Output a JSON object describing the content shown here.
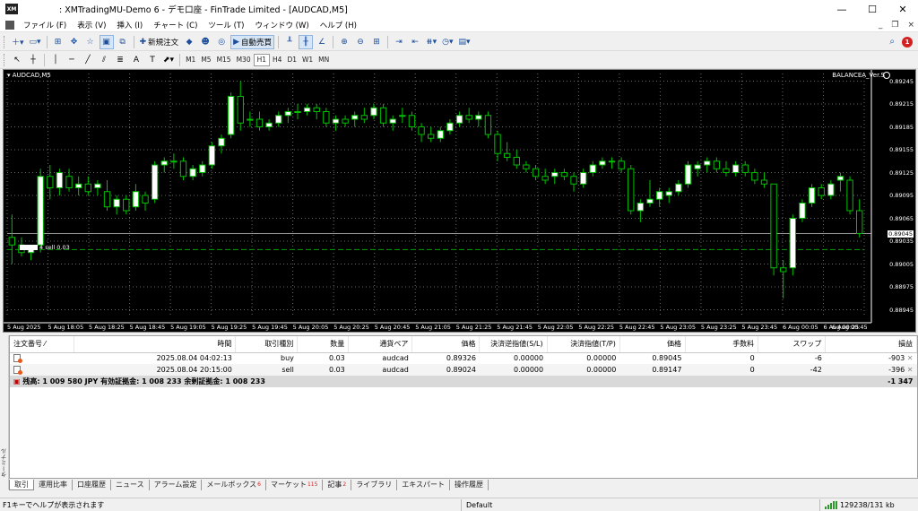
{
  "window": {
    "app_icon_text": "XM",
    "title": ": XMTradingMU-Demo 6 - デモ口座 - FinTrade Limited - [AUDCAD,M5]",
    "minimize": "—",
    "maximize": "☐",
    "close": "✕"
  },
  "menu": {
    "items": [
      "ファイル (F)",
      "表示 (V)",
      "挿入 (I)",
      "チャート (C)",
      "ツール (T)",
      "ウィンドウ (W)",
      "ヘルプ (H)"
    ],
    "mdi_minimize": "_",
    "mdi_restore": "❐",
    "mdi_close": "×"
  },
  "toolbar": {
    "new_order": "新規注文",
    "auto_trade": "自動売買",
    "notifications_count": "1",
    "timeframes": [
      "M1",
      "M5",
      "M15",
      "M30",
      "H1",
      "H4",
      "D1",
      "W1",
      "MN"
    ],
    "active_timeframe": "H1"
  },
  "chart": {
    "symbol": "AUDCAD,M5",
    "ea_label": "BALANCEA_Ver.S",
    "current_price": "0.89045",
    "order_label": "4 sell 0.03",
    "price_labels": [
      "0.89245",
      "0.89215",
      "0.89185",
      "0.89155",
      "0.89125",
      "0.89095",
      "0.89065",
      "0.89035",
      "0.89005",
      "0.88975",
      "0.88945"
    ],
    "time_labels": [
      "5 Aug 2025",
      "5 Aug 18:05",
      "5 Aug 18:25",
      "5 Aug 18:45",
      "5 Aug 19:05",
      "5 Aug 19:25",
      "5 Aug 19:45",
      "5 Aug 20:05",
      "5 Aug 20:25",
      "5 Aug 20:45",
      "5 Aug 21:05",
      "5 Aug 21:25",
      "5 Aug 21:45",
      "5 Aug 22:05",
      "5 Aug 22:25",
      "5 Aug 22:45",
      "5 Aug 23:05",
      "5 Aug 23:25",
      "5 Aug 23:45",
      "6 Aug 00:05",
      "6 Aug 00:25",
      "6 Aug 00:45"
    ],
    "colors": {
      "background": "#000000",
      "bull": "#ffffff",
      "bear": "#000000",
      "wick": "#00c000",
      "order_line": "#00a000"
    }
  },
  "chart_data": {
    "type": "candlestick",
    "title": "AUDCAD,M5",
    "xlabel": "",
    "ylabel": "",
    "ylim": [
      0.88935,
      0.89255
    ],
    "grid": true,
    "candles": [
      [
        0.8904,
        0.8907,
        0.89005,
        0.8903
      ],
      [
        0.8903,
        0.8904,
        0.89015,
        0.8902
      ],
      [
        0.8902,
        0.8903,
        0.8901,
        0.89025
      ],
      [
        0.8903,
        0.8913,
        0.8902,
        0.8912
      ],
      [
        0.8912,
        0.89135,
        0.8909,
        0.89105
      ],
      [
        0.89105,
        0.8913,
        0.89095,
        0.89125
      ],
      [
        0.8912,
        0.8913,
        0.891,
        0.89105
      ],
      [
        0.89105,
        0.8912,
        0.89095,
        0.8911
      ],
      [
        0.8911,
        0.8912,
        0.89095,
        0.891
      ],
      [
        0.89105,
        0.89115,
        0.89095,
        0.8911
      ],
      [
        0.891,
        0.89115,
        0.89075,
        0.8908
      ],
      [
        0.8908,
        0.89095,
        0.8907,
        0.8909
      ],
      [
        0.8909,
        0.89095,
        0.8907,
        0.89075
      ],
      [
        0.8908,
        0.8911,
        0.89075,
        0.891
      ],
      [
        0.89095,
        0.891,
        0.89075,
        0.89085
      ],
      [
        0.8909,
        0.8914,
        0.89085,
        0.89135
      ],
      [
        0.89135,
        0.89145,
        0.89125,
        0.8914
      ],
      [
        0.8914,
        0.8915,
        0.8913,
        0.8914
      ],
      [
        0.8914,
        0.89145,
        0.89115,
        0.8912
      ],
      [
        0.8912,
        0.89135,
        0.89115,
        0.8913
      ],
      [
        0.89125,
        0.8914,
        0.8912,
        0.89135
      ],
      [
        0.89135,
        0.89165,
        0.8913,
        0.8916
      ],
      [
        0.8916,
        0.89175,
        0.8915,
        0.8917
      ],
      [
        0.89175,
        0.8923,
        0.8917,
        0.89225
      ],
      [
        0.89225,
        0.89245,
        0.8918,
        0.8919
      ],
      [
        0.89195,
        0.89205,
        0.89185,
        0.89195
      ],
      [
        0.89195,
        0.89205,
        0.8918,
        0.89185
      ],
      [
        0.89185,
        0.89195,
        0.8918,
        0.8919
      ],
      [
        0.8919,
        0.89205,
        0.89185,
        0.892
      ],
      [
        0.892,
        0.8921,
        0.8919,
        0.89205
      ],
      [
        0.89205,
        0.89215,
        0.89195,
        0.89205
      ],
      [
        0.89205,
        0.89215,
        0.892,
        0.8921
      ],
      [
        0.8921,
        0.89215,
        0.89195,
        0.89205
      ],
      [
        0.89205,
        0.8921,
        0.89185,
        0.8919
      ],
      [
        0.8919,
        0.892,
        0.8918,
        0.89195
      ],
      [
        0.89195,
        0.892,
        0.89185,
        0.8919
      ],
      [
        0.89195,
        0.89205,
        0.89185,
        0.892
      ],
      [
        0.892,
        0.8921,
        0.8919,
        0.89195
      ],
      [
        0.892,
        0.89215,
        0.89195,
        0.8921
      ],
      [
        0.8921,
        0.89215,
        0.89185,
        0.8919
      ],
      [
        0.8919,
        0.892,
        0.8918,
        0.89195
      ],
      [
        0.892,
        0.8921,
        0.8919,
        0.892
      ],
      [
        0.892,
        0.89205,
        0.8918,
        0.89185
      ],
      [
        0.89185,
        0.8919,
        0.89165,
        0.89175
      ],
      [
        0.89175,
        0.89185,
        0.89165,
        0.8917
      ],
      [
        0.8917,
        0.89185,
        0.89165,
        0.8918
      ],
      [
        0.8918,
        0.89195,
        0.89175,
        0.8919
      ],
      [
        0.8919,
        0.89205,
        0.89185,
        0.892
      ],
      [
        0.892,
        0.8921,
        0.8919,
        0.89195
      ],
      [
        0.89195,
        0.89205,
        0.89185,
        0.892
      ],
      [
        0.892,
        0.89205,
        0.8917,
        0.89175
      ],
      [
        0.89175,
        0.8918,
        0.8914,
        0.8915
      ],
      [
        0.8915,
        0.89165,
        0.8914,
        0.89145
      ],
      [
        0.89145,
        0.89155,
        0.8913,
        0.89135
      ],
      [
        0.89135,
        0.8914,
        0.89125,
        0.8913
      ],
      [
        0.8913,
        0.89135,
        0.89115,
        0.8912
      ],
      [
        0.8912,
        0.8913,
        0.8911,
        0.89115
      ],
      [
        0.8912,
        0.8913,
        0.8911,
        0.89125
      ],
      [
        0.89125,
        0.8913,
        0.89115,
        0.8912
      ],
      [
        0.8912,
        0.89125,
        0.891,
        0.8911
      ],
      [
        0.8911,
        0.8913,
        0.89105,
        0.89125
      ],
      [
        0.89125,
        0.8914,
        0.8912,
        0.89135
      ],
      [
        0.89135,
        0.89145,
        0.8913,
        0.8914
      ],
      [
        0.8914,
        0.89145,
        0.8913,
        0.8914
      ],
      [
        0.8914,
        0.89145,
        0.89125,
        0.8913
      ],
      [
        0.8913,
        0.89135,
        0.8907,
        0.89075
      ],
      [
        0.89075,
        0.8909,
        0.8906,
        0.89085
      ],
      [
        0.89085,
        0.89115,
        0.8908,
        0.8909
      ],
      [
        0.8909,
        0.89105,
        0.8908,
        0.891
      ],
      [
        0.89095,
        0.89105,
        0.89085,
        0.891
      ],
      [
        0.891,
        0.89115,
        0.89095,
        0.8911
      ],
      [
        0.8911,
        0.8914,
        0.89105,
        0.89135
      ],
      [
        0.8913,
        0.8914,
        0.8912,
        0.89135
      ],
      [
        0.89135,
        0.89145,
        0.89125,
        0.8914
      ],
      [
        0.8914,
        0.89145,
        0.89125,
        0.8913
      ],
      [
        0.8913,
        0.8914,
        0.8912,
        0.89125
      ],
      [
        0.89125,
        0.8914,
        0.8912,
        0.89135
      ],
      [
        0.89135,
        0.8914,
        0.8912,
        0.89125
      ],
      [
        0.89125,
        0.8913,
        0.8911,
        0.89115
      ],
      [
        0.89115,
        0.89125,
        0.89105,
        0.8911
      ],
      [
        0.8911,
        0.8911,
        0.8899,
        0.89
      ],
      [
        0.89,
        0.8901,
        0.8896,
        0.88995
      ],
      [
        0.89,
        0.8907,
        0.8899,
        0.89065
      ],
      [
        0.89065,
        0.8909,
        0.8906,
        0.89085
      ],
      [
        0.89085,
        0.8911,
        0.8908,
        0.89105
      ],
      [
        0.89105,
        0.8911,
        0.8909,
        0.89095
      ],
      [
        0.89095,
        0.89115,
        0.8909,
        0.8911
      ],
      [
        0.89115,
        0.89125,
        0.891,
        0.8912
      ],
      [
        0.89115,
        0.8912,
        0.8907,
        0.89075
      ],
      [
        0.89075,
        0.8909,
        0.8904,
        0.89045
      ]
    ],
    "order_line_price": 0.89024
  },
  "terminal": {
    "side_label": "ターミナル",
    "columns": [
      "注文番号",
      "時間",
      "取引種別",
      "数量",
      "通貨ペア",
      "価格",
      "決済逆指値(S/L)",
      "決済指値(T/P)",
      "価格",
      "手数料",
      "スワップ",
      "損益"
    ],
    "rows": [
      {
        "ticket": "",
        "time": "2025.08.04 04:02:13",
        "type": "buy",
        "volume": "0.03",
        "symbol": "audcad",
        "open": "0.89326",
        "sl": "0.00000",
        "tp": "0.00000",
        "price": "0.89045",
        "commission": "0",
        "swap": "-6",
        "profit": "-903"
      },
      {
        "ticket": "",
        "time": "2025.08.04 20:15:00",
        "type": "sell",
        "volume": "0.03",
        "symbol": "audcad",
        "open": "0.89024",
        "sl": "0.00000",
        "tp": "0.00000",
        "price": "0.89147",
        "commission": "0",
        "swap": "-42",
        "profit": "-396"
      }
    ],
    "summary": "残高: 1 009 580 JPY  有効証拠金: 1 008 233  余剰証拠金: 1 008 233",
    "summary_profit": "-1 347",
    "tabs": [
      {
        "label": "取引",
        "badge": ""
      },
      {
        "label": "運用比率",
        "badge": ""
      },
      {
        "label": "口座履歴",
        "badge": ""
      },
      {
        "label": "ニュース",
        "badge": ""
      },
      {
        "label": "アラーム設定",
        "badge": ""
      },
      {
        "label": "メールボックス",
        "badge": "6"
      },
      {
        "label": "マーケット",
        "badge": "115"
      },
      {
        "label": "記事",
        "badge": "2"
      },
      {
        "label": "ライブラリ",
        "badge": ""
      },
      {
        "label": "エキスパート",
        "badge": ""
      },
      {
        "label": "操作履歴",
        "badge": ""
      }
    ]
  },
  "status": {
    "help": "F1キーでヘルプが表示されます",
    "profile": "Default",
    "connection": "129238/131 kb"
  }
}
